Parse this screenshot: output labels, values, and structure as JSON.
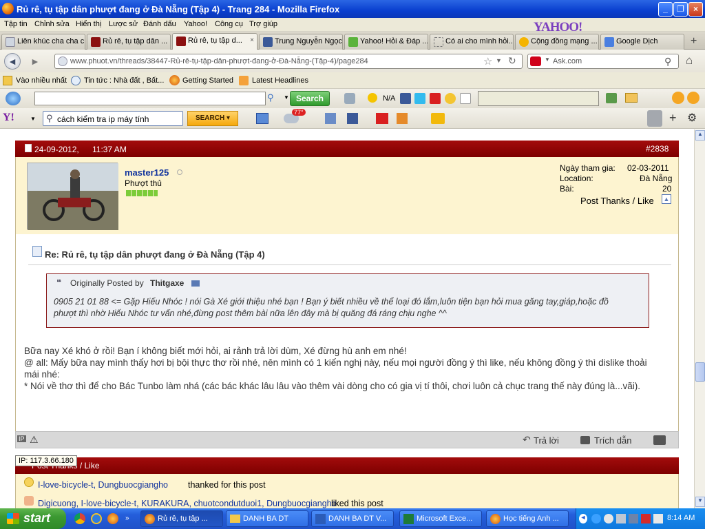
{
  "window": {
    "title": "Rủ rê, tụ tập dân phượt đang ở Đà Nẵng (Tập 4) - Trang 284 - Mozilla Firefox",
    "controls": [
      "_",
      "❐",
      "×"
    ]
  },
  "menu": [
    "Tập tin",
    "Chỉnh sửa",
    "Hiển thị",
    "Lược sử",
    "Đánh dấu",
    "Yahoo!",
    "Công cụ",
    "Trợ giúp"
  ],
  "yahoo_logo": "YAHOO!",
  "tabs": [
    {
      "label": "Liên khúc cha cha c...",
      "icon": "page-icon"
    },
    {
      "label": "Rủ rê, tụ tập dân ...",
      "icon": "forum-icon"
    },
    {
      "label": "Rủ rê, tụ tập d...",
      "icon": "forum-icon",
      "close": "×"
    },
    {
      "label": "Trung Nguyễn Ngọc",
      "icon": "facebook-icon"
    },
    {
      "label": "Yahoo! Hỏi & Đáp ...",
      "icon": "yahoo-answers-icon"
    },
    {
      "label": "Có ai cho mình hỏi...",
      "icon": "page-icon"
    },
    {
      "label": "Cộng đồng mạng ...",
      "icon": "yahoo-icon"
    },
    {
      "label": "Google Dịch",
      "icon": "translate-icon"
    }
  ],
  "tab_add": "+",
  "url": "www.phuot.vn/threads/38447-Rủ-rê-tụ-tập-dân-phượt-đang-ở-Đà-Nẵng-(Tập-4)/page284",
  "search_engine": "Ask.com",
  "bookmarks": [
    "Vào nhiều nhất",
    "Tin tức : Nhà đất , Bất...",
    "Getting Started",
    "Latest Headlines"
  ],
  "toolbar1": {
    "search_button": "Search",
    "weather": "N/A"
  },
  "toolbar2": {
    "search_value": "cách kiểm tra ip máy tính",
    "search_button": "SEARCH",
    "temperature": "77°"
  },
  "post": {
    "date": "24-09-2012,",
    "time": "11:37 AM",
    "number": "#2838",
    "username": "master125",
    "user_title": "Phượt thủ",
    "join_label": "Ngày tham gia:",
    "join_date": "02-03-2011",
    "location_label": "Location:",
    "location": "Đà Nẵng",
    "posts_label": "Bài:",
    "posts_count": "20",
    "thanks_link": "Post Thanks / Like",
    "title": "Re: Rủ rê, tụ tập dân phượt đang ở Đà Nẵng (Tập 4)",
    "quote_prefix": "Originally Posted by",
    "quote_author": "Thitgaxe",
    "quote_text": "0905 21 01 88 <= Gặp Hiếu Nhóc ! nói Gà Xé giới thiệu nhé bạn ! Bạn ý biết nhiều về thể loại đó lắm,luôn tiện bạn hỏi mua găng tay,giáp,hoặc đồ phượt thì nhờ Hiếu Nhóc tư vấn nhé,đừng post thêm bài nữa lên đây mà bị quăng đá ráng chịu nghe ^^",
    "body": [
      "Bữa nay Xé khó ở rồi! Bạn í không biết mới hỏi, ai rảnh trả lời dùm, Xé đừng hù anh em nhé!",
      "@ all: Mấy bữa nay mình thấy hơi bị bội thực thơ rồi nhé, nên mình có 1 kiến nghị này, nếu mọi người đồng ý thì like, nếu không đồng ý thì dislike thoải mái nhé:",
      "* Nói về thơ thì để cho Bác Tunbo làm nhá (các bác khác lâu lâu vào thêm vài dòng cho có gia vị tí thôi, chơi luôn cả chục trang thế này đúng là...vãi)."
    ],
    "ip_tag": "IP",
    "reply_label": "Trả lời",
    "quote_label": "Trích dẫn",
    "ip_tooltip": "IP: 117.3.66.180"
  },
  "thanks": {
    "header": "Post Thanks / Like",
    "thanked_users": "I-love-bicycle-t, Dungbuocgiangho",
    "thanked_suffix": "thanked for this post",
    "liked_users": "Digicuong, I-love-bicycle-t, KURAKURA, chuotcondutduoi1, Dungbuocgiangho",
    "liked_suffix": "liked this post"
  },
  "taskbar": {
    "start": "start",
    "tasks": [
      {
        "label": "Rủ rê, tụ tập ...",
        "icon": "firefox-icon"
      },
      {
        "label": "DANH BA DT",
        "icon": "folder-icon"
      },
      {
        "label": "DANH BA DT V...",
        "icon": "word-icon"
      },
      {
        "label": "Microsoft Exce...",
        "icon": "excel-icon"
      },
      {
        "label": "Học tiếng Anh ...",
        "icon": "firefox-icon"
      }
    ],
    "clock": "8:14 AM"
  }
}
